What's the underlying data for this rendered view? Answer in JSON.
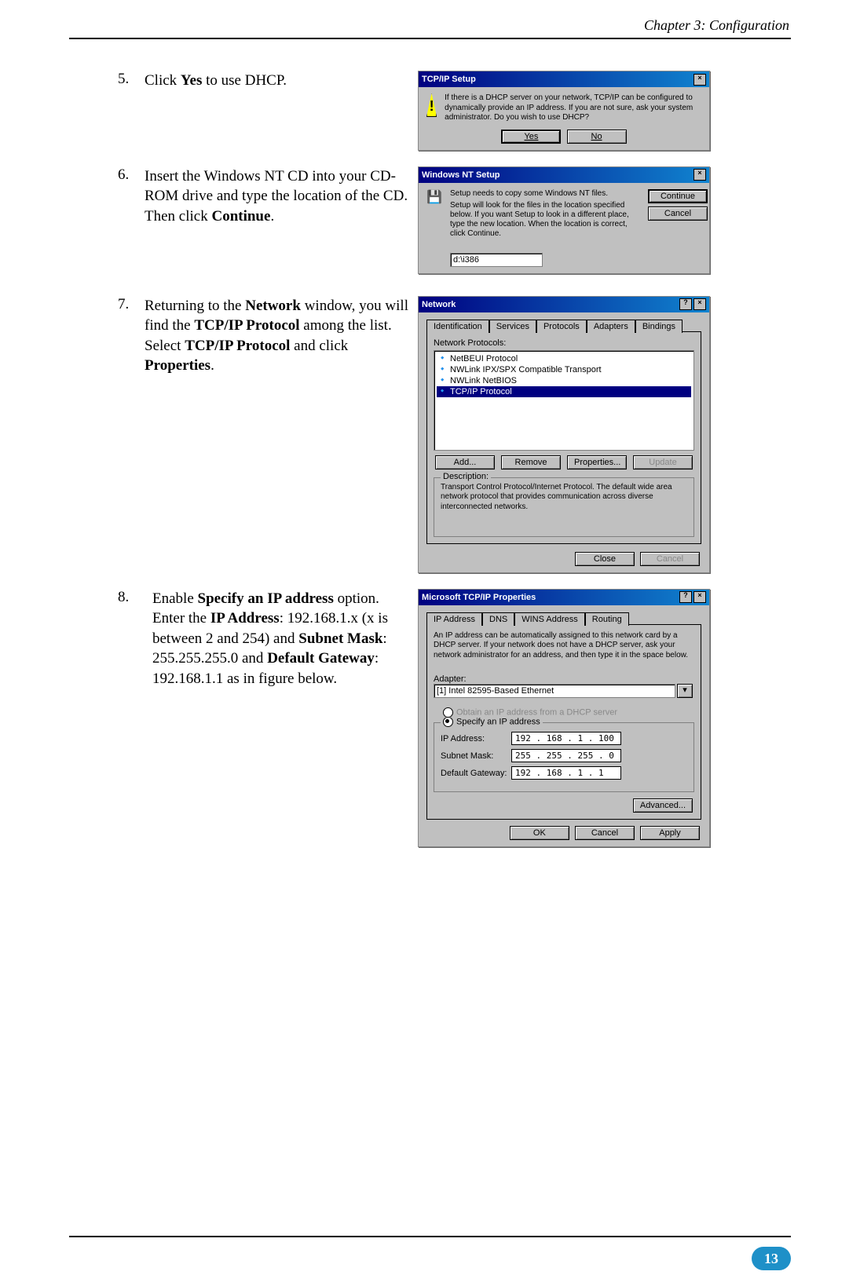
{
  "header": {
    "chapter": "Chapter 3: Configuration"
  },
  "footer": {
    "page": "13"
  },
  "steps": {
    "s5": {
      "num": "5.",
      "text_a": "Click ",
      "bold_a": "Yes",
      "text_b": " to use DHCP."
    },
    "s6": {
      "num": "6.",
      "text_a": "Insert the Windows NT CD into your CD-ROM drive and type the location of the CD. Then click ",
      "bold_a": "Continue",
      "text_b": "."
    },
    "s7": {
      "num": "7.",
      "text_a": "Returning to the ",
      "bold_a": "Network",
      "text_b": " window, you will find the ",
      "bold_b": "TCP/IP Protocol",
      "text_c": " among the list. Select ",
      "bold_c": "TCP/IP Protocol",
      "text_d": " and click ",
      "bold_d": "Properties",
      "text_e": "."
    },
    "s8": {
      "num": "8.",
      "text_a": "Enable ",
      "bold_a": "Specify an IP address",
      "text_b": " option. Enter the ",
      "bold_b": "IP Address",
      "text_c": ": 192.168.1.x (x is between 2 and 254) and ",
      "bold_c": "Subnet Mask",
      "text_d": ": 255.255.255.0 and ",
      "bold_d": "Default Gateway",
      "text_e": ": 192.168.1.1 as in figure below."
    }
  },
  "dlg5": {
    "title": "TCP/IP Setup",
    "msg": "If there is a DHCP server on your network, TCP/IP can be configured to dynamically provide an IP address. If you are not sure, ask your system administrator. Do you wish to use DHCP?",
    "yes": "Yes",
    "no": "No"
  },
  "dlg6": {
    "title": "Windows NT Setup",
    "line1": "Setup needs to copy some Windows NT files.",
    "line2": "Setup will look for the files in the location specified below. If you want Setup to look in a different place, type the new location. When the location is correct, click Continue.",
    "path": "d:\\i386",
    "continue": "Continue",
    "cancel": "Cancel"
  },
  "dlg7": {
    "title": "Network",
    "tabs": {
      "t1": "Identification",
      "t2": "Services",
      "t3": "Protocols",
      "t4": "Adapters",
      "t5": "Bindings"
    },
    "listlabel": "Network Protocols:",
    "items": {
      "i1": "NetBEUI Protocol",
      "i2": "NWLink IPX/SPX Compatible Transport",
      "i3": "NWLink NetBIOS",
      "i4": "TCP/IP Protocol"
    },
    "btns": {
      "add": "Add...",
      "remove": "Remove",
      "props": "Properties...",
      "update": "Update"
    },
    "desclabel": "Description:",
    "desc": "Transport Control Protocol/Internet Protocol. The default wide area network protocol that provides communication across diverse interconnected networks.",
    "close": "Close",
    "cancel": "Cancel"
  },
  "dlg8": {
    "title": "Microsoft TCP/IP Properties",
    "tabs": {
      "t1": "IP Address",
      "t2": "DNS",
      "t3": "WINS Address",
      "t4": "Routing"
    },
    "intro": "An IP address can be automatically assigned to this network card by a DHCP server. If your network does not have a DHCP server, ask your network administrator for an address, and then type it in the space below.",
    "adapterlabel": "Adapter:",
    "adapter": "[1] Intel 82595-Based Ethernet",
    "opt1": "Obtain an IP address from a DHCP server",
    "opt2": "Specify an IP address",
    "iplabel": "IP Address:",
    "ip": "192 . 168 .  1   . 100",
    "smlabel": "Subnet Mask:",
    "sm": "255 . 255 . 255 .  0",
    "gwlabel": "Default Gateway:",
    "gw": "192 . 168 .  1   .  1",
    "advanced": "Advanced...",
    "ok": "OK",
    "cancel": "Cancel",
    "apply": "Apply"
  }
}
